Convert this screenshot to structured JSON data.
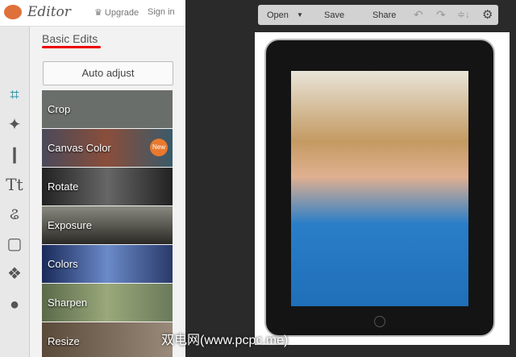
{
  "header": {
    "app_title": "Editor",
    "upgrade": "Upgrade",
    "sign_in": "Sign in"
  },
  "sidebar": {
    "icons": [
      "crop-icon",
      "effects-wand-icon",
      "touch-up-icon",
      "text-icon",
      "overlays-butterfly-icon",
      "frames-icon",
      "textures-icon",
      "seasonal-apple-icon"
    ]
  },
  "panel": {
    "title": "Basic Edits",
    "auto_adjust": "Auto adjust",
    "tools": [
      {
        "label": "Crop",
        "bg": "#6a6e6a"
      },
      {
        "label": "Canvas Color",
        "bg": "#8a4e3a",
        "badge": "New"
      },
      {
        "label": "Rotate",
        "bg": "#3a3a3a"
      },
      {
        "label": "Exposure",
        "bg": "#4c4a44"
      },
      {
        "label": "Colors",
        "bg": "#2a3a6a"
      },
      {
        "label": "Sharpen",
        "bg": "#6a7a5a"
      },
      {
        "label": "Resize",
        "bg": "#6e5a4a"
      }
    ]
  },
  "toolbar": {
    "open": "Open",
    "save": "Save",
    "share": "Share"
  },
  "watermark": "双电网(www.pcpc.me)",
  "colors": {
    "accent": "#e00000",
    "badge": "#e8792e"
  }
}
